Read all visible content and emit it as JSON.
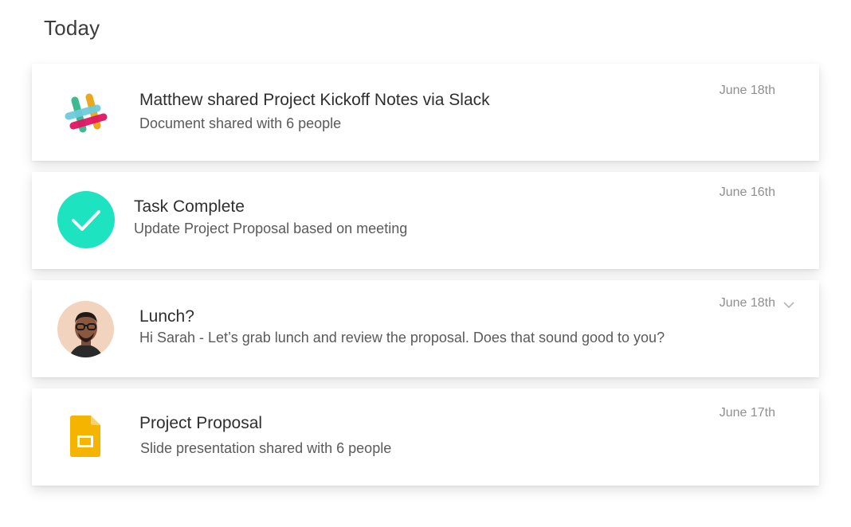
{
  "section": {
    "title": "Today"
  },
  "colors": {
    "task_complete": "#1ee3c0",
    "slides_yellow": "#f4b400",
    "slack_green": "#3eb991",
    "slack_blue": "#6ecadc",
    "slack_yellow": "#e9a820",
    "slack_red": "#e01563"
  },
  "notifications": [
    {
      "icon": "slack-logo-icon",
      "title": "Matthew shared Project Kickoff Notes via Slack",
      "subtitle": "Document shared with 6 people",
      "date": "June 18th"
    },
    {
      "icon": "check-circle-icon",
      "title": "Task Complete",
      "subtitle": "Update Project Proposal based on meeting",
      "date": "June 16th"
    },
    {
      "icon": "avatar",
      "title": "Lunch?",
      "subtitle": "Hi Sarah - Let’s grab lunch and review the proposal. Does that sound good to you?",
      "date": "June 18th",
      "expand_icon": "chevron-down-icon"
    },
    {
      "icon": "google-slides-icon",
      "title": "Project Proposal",
      "subtitle": "Slide presentation shared with 6 people",
      "date": "June 17th"
    }
  ]
}
